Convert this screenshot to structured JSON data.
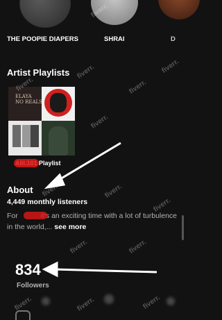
{
  "related_artists": [
    {
      "name": "THE POOPIE DIAPERS"
    },
    {
      "name": "SHRAI"
    },
    {
      "name": "D"
    }
  ],
  "artist_playlists": {
    "title": "Artist Playlists",
    "items": [
      {
        "name": "Alli.101 Playlist"
      }
    ],
    "cover_text": "ELAYA\nNO REALS"
  },
  "about": {
    "title": "About",
    "monthly_listeners": "4,449 monthly listeners",
    "bio_prefix": "For ",
    "bio_text": "it's an exciting time with a lot of turbulence in the world,... ",
    "see_more": "see more"
  },
  "followers": {
    "count": "834",
    "label": "Followers"
  },
  "watermark_text": "fiverr.",
  "annotation_arrow_color": "#ffffff",
  "redaction_color": "#e01818"
}
